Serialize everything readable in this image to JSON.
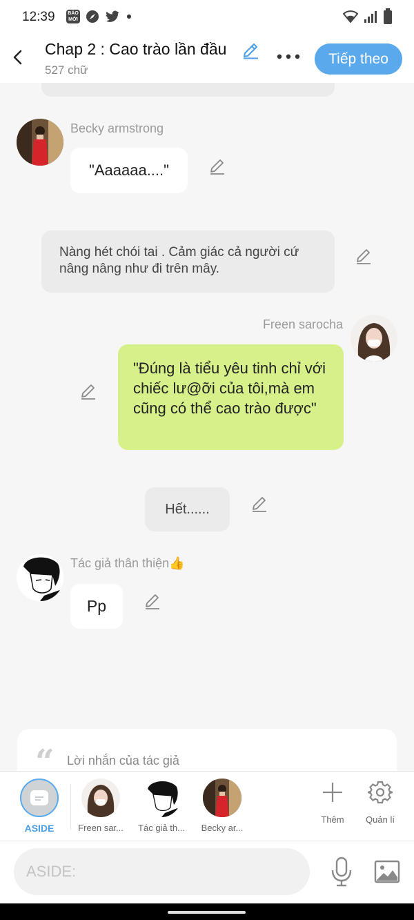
{
  "status_bar": {
    "time": "12:39",
    "baomoi_icon_text": "BÁO MỚI"
  },
  "header": {
    "title": "Chap 2 : Cao trào lần đầu",
    "word_count": "527 chữ",
    "next_label": "Tiếp theo"
  },
  "messages": [
    {
      "speaker": "Becky armstrong",
      "text": "\"Aaaaaa....\""
    },
    {
      "speaker": "",
      "text": "Nàng hét chói tai . Cảm giác cả người cứ nâng nâng như đi trên mây."
    },
    {
      "speaker": "Freen sarocha",
      "text": "\"Đúng là tiểu yêu tinh chỉ với chiếc lư@ỡi của tôi,mà em cũng có thể cao trào được\""
    },
    {
      "speaker": "",
      "text": "Hết......"
    },
    {
      "speaker": "Tác giả thân thiện👍",
      "text": "Pp"
    }
  ],
  "author_note": {
    "label": "Lời nhắn của tác giả"
  },
  "characters": {
    "aside_label": "ASIDE",
    "items": [
      {
        "label": "Freen sar..."
      },
      {
        "label": "Tác giả th..."
      },
      {
        "label": "Becky ar..."
      }
    ],
    "add_label": "Thêm",
    "manage_label": "Quản lí"
  },
  "composer": {
    "placeholder": "ASIDE:"
  },
  "colors": {
    "accent": "#5aa9ec",
    "green_bubble": "#d6f08a",
    "grey_bubble": "#ebebeb",
    "background": "#f6f6f6"
  },
  "icons": [
    "back-icon",
    "pencil-icon",
    "more-icon",
    "plus-icon",
    "gear-icon",
    "mic-icon",
    "image-icon",
    "quote-icon",
    "wifi-icon",
    "signal-icon",
    "battery-icon"
  ]
}
